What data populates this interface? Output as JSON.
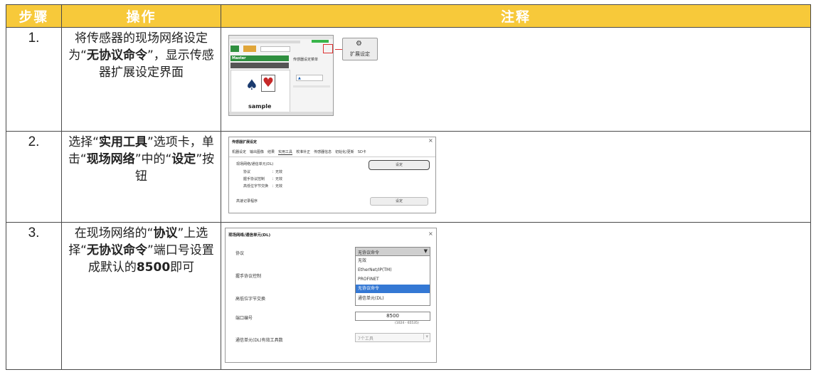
{
  "headers": {
    "step": "步骤",
    "operation": "操作",
    "note": "注释"
  },
  "rows": [
    {
      "number": "1.",
      "operation": [
        "将传感器的现场网络设定为“",
        {
          "b": "无协议命令"
        },
        "”，显示传感器扩展设定界面"
      ],
      "screenshot": {
        "master_label": "Master",
        "panel_caption": "传感器设定菜单",
        "sample_text": "sample",
        "callout_label": "扩展设定"
      }
    },
    {
      "number": "2.",
      "operation": [
        "选择“",
        {
          "b": "实用工具"
        },
        "”选项卡，单击“",
        {
          "b": "现场网络"
        },
        "”中的“",
        {
          "b": "设定"
        },
        "”按钮"
      ],
      "screenshot": {
        "title": "传感器扩展设定",
        "tabs": [
          "机器设定",
          "输出图像",
          "结果",
          "实用工具",
          "校准补正",
          "传感器信息",
          "初始化/更新",
          "SD卡"
        ],
        "section_label": "现场网络/通信单元(DL)",
        "fields": [
          {
            "label": "协议",
            "value": "：无效"
          },
          {
            "label": "握手协议控制",
            "value": "：无效"
          },
          {
            "label": "高低位字节交换",
            "value": "：无效"
          }
        ],
        "set_button": "设定",
        "second_label": "高速记录程序",
        "second_button": "设定"
      }
    },
    {
      "number": "3.",
      "operation": [
        "在现场网络的“",
        {
          "b": "协议"
        },
        "”上选择“",
        {
          "b": "无协议命令"
        },
        "”端口号设置成默认的",
        {
          "b": "8500"
        },
        "即可"
      ],
      "screenshot": {
        "title": "现场网络/通信单元(DL)",
        "protocol_label": "协议",
        "selected_protocol": "无协议命令",
        "dropdown_options": [
          "无效",
          "EtherNet/IP(TM)",
          "PROFINET",
          "无协议命令",
          "通信单元(DL)"
        ],
        "highlighted_index": 3,
        "handshake_label": "握手协议控制",
        "byteswap_label": "高低位字节交换",
        "port_label": "端口编号",
        "port_value": "8500",
        "port_range": "(1024 - 65535)",
        "tools_label": "通信单元(DL)有效工具数",
        "tools_value": "7个工具"
      }
    }
  ],
  "colors": {
    "header_bg": "#f7c93a",
    "header_text": "#ffffff",
    "highlight": "#3478d4"
  }
}
